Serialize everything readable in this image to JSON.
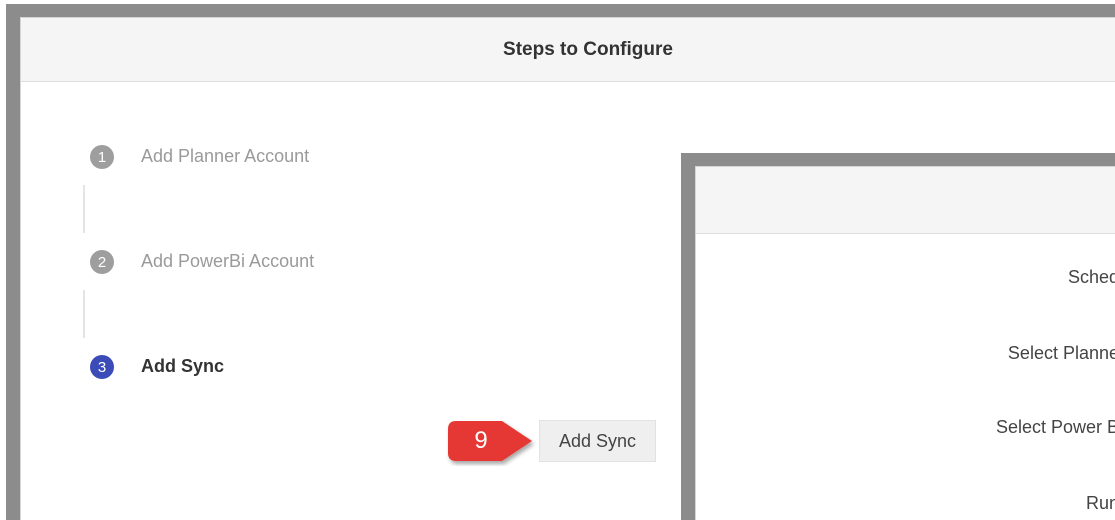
{
  "panel": {
    "title": "Steps to Configure"
  },
  "steps": [
    {
      "number": "1",
      "label": "Add Planner Account",
      "state": "completed"
    },
    {
      "number": "2",
      "label": "Add PowerBi Account",
      "state": "completed"
    },
    {
      "number": "3",
      "label": "Add Sync",
      "state": "active"
    }
  ],
  "actions": {
    "add_sync_label": "Add Sync"
  },
  "callout": {
    "number": "9",
    "color": "#e53935"
  },
  "dialog": {
    "labels": {
      "schedule": "Sched",
      "select_planner": "Select Planne",
      "select_power_bi": "Select Power B",
      "run": "Run"
    }
  },
  "colors": {
    "active_step": "#3b4cb8",
    "inactive_step": "#9e9e9e"
  }
}
